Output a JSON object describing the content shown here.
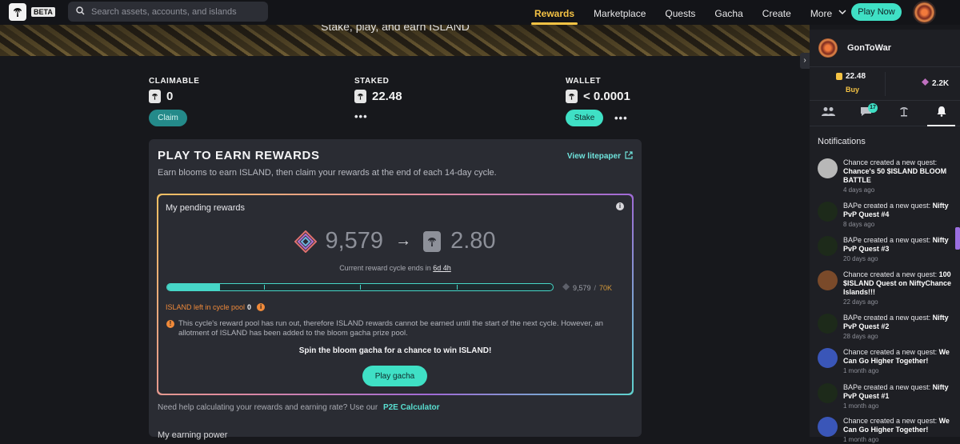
{
  "header": {
    "beta": "BETA",
    "search_placeholder": "Search assets, accounts, and islands",
    "nav": [
      "Rewards",
      "Marketplace",
      "Quests",
      "Gacha",
      "Create",
      "More"
    ],
    "play_now": "Play Now"
  },
  "banner": {
    "text": "Stake, play, and earn ISLAND"
  },
  "stats": {
    "claimable": {
      "label": "CLAIMABLE",
      "value": "0",
      "button": "Claim"
    },
    "staked": {
      "label": "STAKED",
      "value": "22.48",
      "more": "•••"
    },
    "wallet": {
      "label": "WALLET",
      "value": "< 0.0001",
      "button": "Stake",
      "more": "•••"
    }
  },
  "card": {
    "title": "PLAY TO EARN REWARDS",
    "litepaper": "View litepaper",
    "subtitle": "Earn blooms to earn ISLAND, then claim your rewards at the end of each 14-day cycle.",
    "pending": {
      "title": "My pending rewards",
      "blooms": "9,579",
      "island": "2.80",
      "cycle_prefix": "Current reward cycle ends in",
      "cycle_value": "6d 4h",
      "progress_fraction": 0.137,
      "bar_current": "9,579",
      "bar_sep": "/",
      "bar_max": "70K",
      "pool_label": "ISLAND left in cycle pool",
      "pool_value": "0",
      "warning": "This cycle's reward pool has run out, therefore ISLAND rewards cannot be earned until the start of the next cycle. However, an allotment of ISLAND has been added to the bloom gacha prize pool.",
      "spin": "Spin the bloom gacha for a chance to win ISLAND!",
      "play_gacha": "Play gacha"
    },
    "help_text": "Need help calculating your rewards and earning rate? Use our",
    "help_link": "P2E Calculator",
    "earning_title": "My earning power"
  },
  "sidebar": {
    "username": "GonToWar",
    "island_balance": "22.48",
    "buy": "Buy",
    "bloom_balance": "2.2K",
    "chat_badge": "17",
    "notifications_title": "Notifications",
    "notifications": [
      {
        "text": "Chance created a new quest: ",
        "quest": "Chance's 50 $ISLAND BLOOM BATTLE",
        "time": "4 days ago",
        "color": "#b8b8b8"
      },
      {
        "text": "BAPe created a new quest: ",
        "quest": "Nifty PvP Quest #4",
        "time": "8 days ago",
        "color": "#1d2a1a"
      },
      {
        "text": "BAPe created a new quest: ",
        "quest": "Nifty PvP Quest #3",
        "time": "20 days ago",
        "color": "#1d2a1a"
      },
      {
        "text": "Chance created a new quest: ",
        "quest": "100 $ISLAND Quest on NiftyChance Islands!!!",
        "time": "22 days ago",
        "color": "#7a4a2a"
      },
      {
        "text": "BAPe created a new quest: ",
        "quest": "Nifty PvP Quest #2",
        "time": "28 days ago",
        "color": "#1d2a1a"
      },
      {
        "text": "Chance created a new quest: ",
        "quest": "We Can Go Higher Together!",
        "time": "1 month ago",
        "color": "#3a56b8"
      },
      {
        "text": "BAPe created a new quest: ",
        "quest": "Nifty PvP Quest #1",
        "time": "1 month ago",
        "color": "#1d2a1a"
      },
      {
        "text": "Chance created a new quest: ",
        "quest": "We Can Go Higher Together!",
        "time": "1 month ago",
        "color": "#3a56b8"
      }
    ]
  }
}
